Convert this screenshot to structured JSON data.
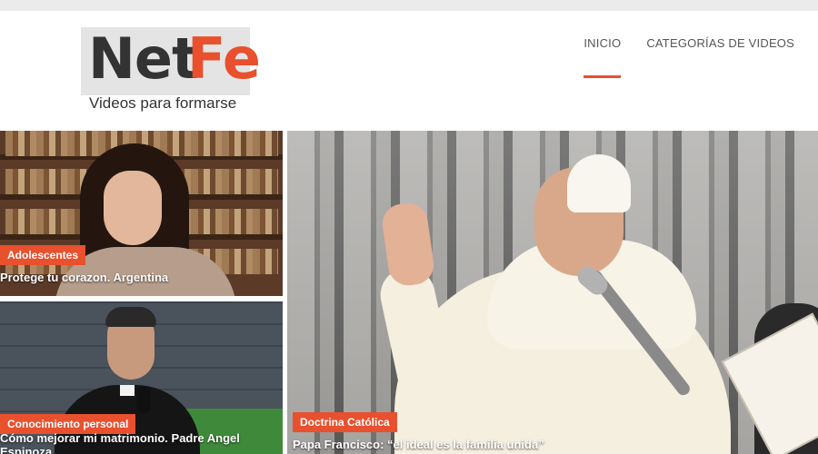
{
  "header": {
    "logo": {
      "net": "Net",
      "fe": "Fe",
      "tagline": "Videos para formarse"
    },
    "nav": [
      {
        "label": "INICIO",
        "active": true
      },
      {
        "label": "CATEGORÍAS DE VIDEOS",
        "active": false
      }
    ]
  },
  "videos": [
    {
      "category": "Adolescentes",
      "title": "Protege tu corazon. Argentina"
    },
    {
      "category": "Conocimiento personal",
      "title": "Cómo mejorar mi matrimonio. Padre Angel Espinoza"
    },
    {
      "category": "Doctrina Católica",
      "title": "Papa Francisco: “el ideal es la familia unida”"
    }
  ],
  "colors": {
    "accent": "#e8502e",
    "topbar": "#ebebeb",
    "text": "#555555"
  }
}
